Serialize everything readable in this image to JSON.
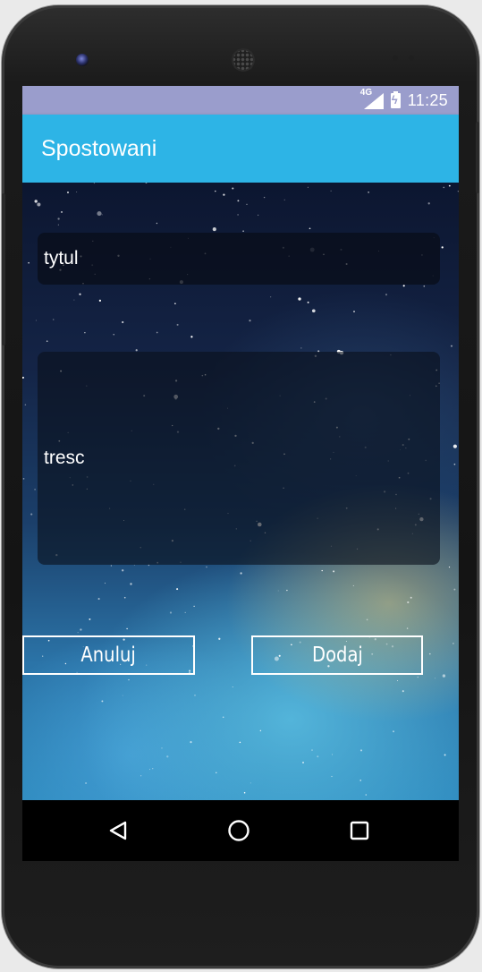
{
  "status_bar": {
    "network": "4G",
    "time": "11:25"
  },
  "app_bar": {
    "title": "Spostowani"
  },
  "form": {
    "title_field": {
      "placeholder": "tytul"
    },
    "content_field": {
      "placeholder": "tresc"
    }
  },
  "buttons": {
    "cancel_label": "Anuluj",
    "add_label": "Dodaj"
  },
  "nav_bar": {
    "icons": [
      "back-icon",
      "home-icon",
      "recents-icon"
    ]
  },
  "colors": {
    "status_bar": "#9a9dcc",
    "app_bar": "#2db4e6",
    "text": "#ffffff"
  }
}
